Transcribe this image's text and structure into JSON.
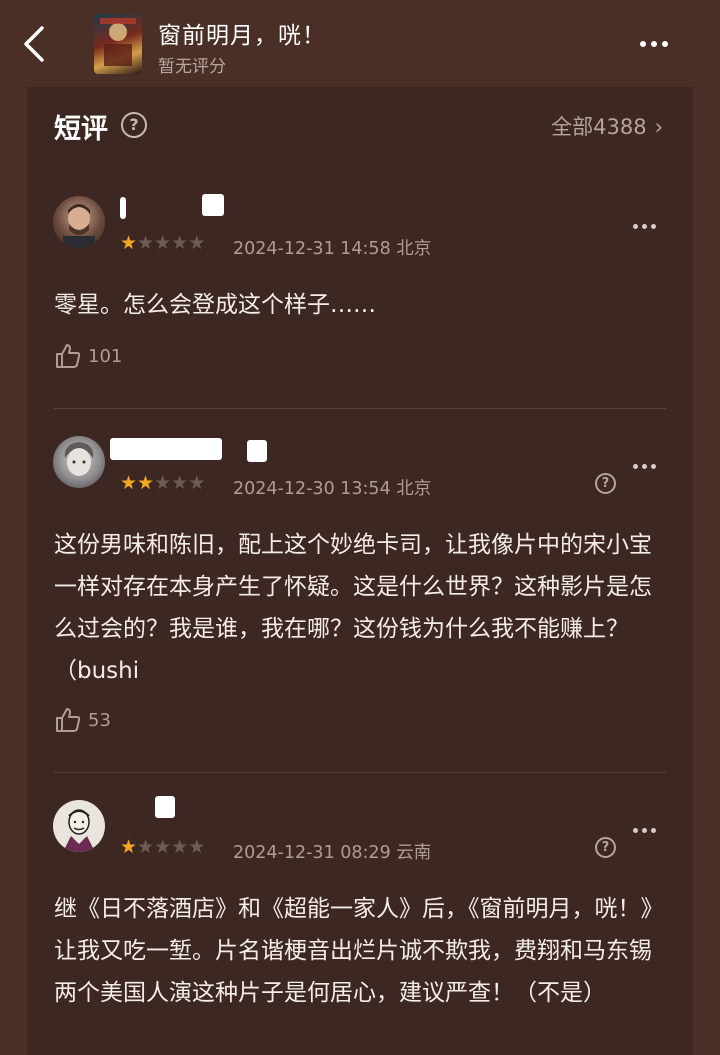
{
  "header": {
    "title": "窗前明月，咣！",
    "subtitle": "暂无评分"
  },
  "section": {
    "title": "短评",
    "help": "?",
    "all_label": "全部4388",
    "chevron": "›"
  },
  "reviews": [
    {
      "avatar": "avatar-photo-man",
      "rating": 1,
      "date": "2024-12-31 14:58",
      "location": "北京",
      "text": "零星。怎么会登成这个样子……",
      "likes": "101",
      "has_help": false
    },
    {
      "avatar": "avatar-photo-person",
      "rating": 2,
      "date": "2024-12-30 13:54",
      "location": "北京",
      "text": "这份男味和陈旧，配上这个妙绝卡司，让我像片中的宋小宝一样对存在本身产生了怀疑。这是什么世界？这种影片是怎么过会的？我是谁，我在哪？这份钱为什么我不能赚上？（bushi",
      "likes": "53",
      "has_help": true
    },
    {
      "avatar": "avatar-cartoon-man",
      "rating": 1,
      "date": "2024-12-31 08:29",
      "location": "云南",
      "text": "继《日不落酒店》和《超能一家人》后，《窗前明月，咣！》让我又吃一堑。片名谐梗音出烂片诚不欺我，费翔和马东锡两个美国人演这种片子是何居心，建议严查！（不是）",
      "likes": "",
      "has_help": true
    }
  ],
  "colors": {
    "background": "#4a2f26",
    "card": "#3c2723",
    "star_on": "#f5a623",
    "star_off": "#6d5b56"
  }
}
